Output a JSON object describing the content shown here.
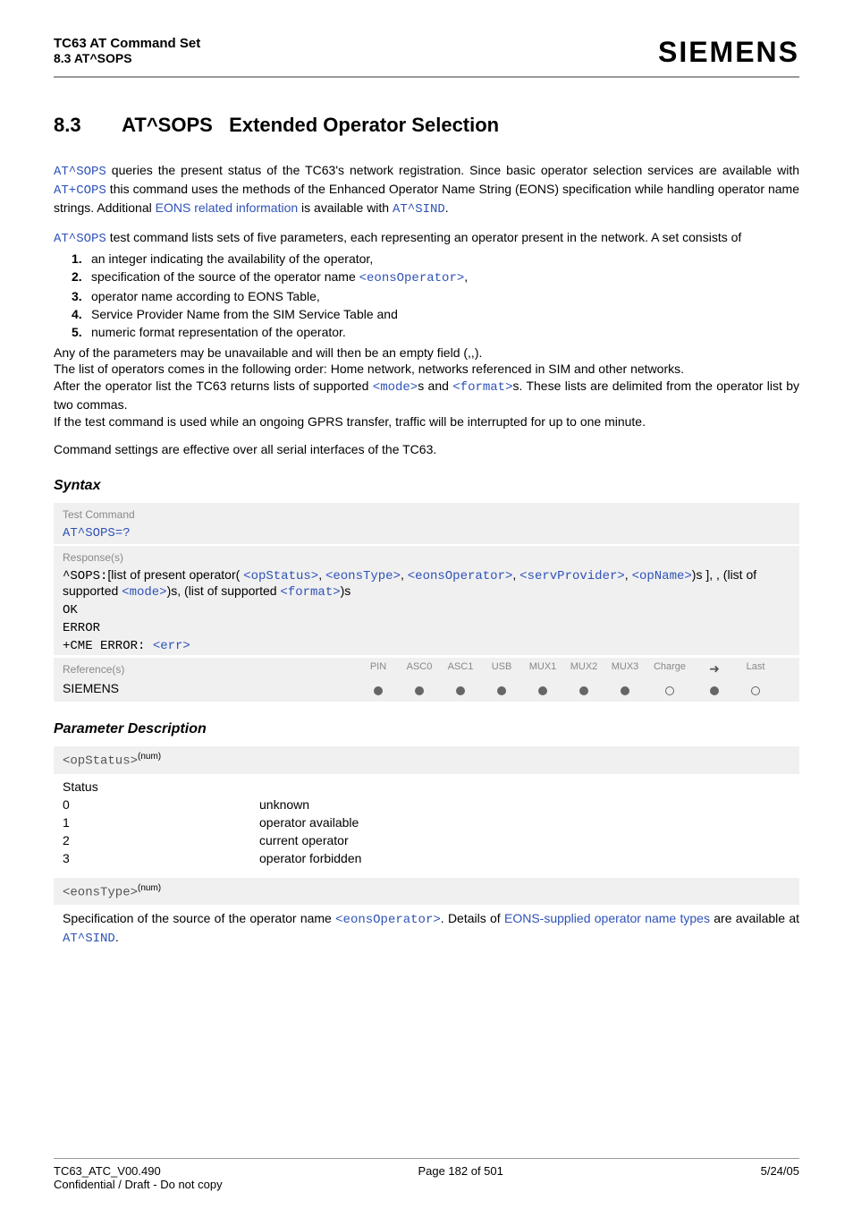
{
  "header": {
    "doc_title": "TC63 AT Command Set",
    "section_label": "8.3 AT^SOPS",
    "brand": "SIEMENS"
  },
  "title": {
    "number": "8.3",
    "cmd": "AT^SOPS",
    "desc": "Extended Operator Selection"
  },
  "intro": {
    "cmd1": "AT^SOPS",
    "p1_part1": " queries the present status of the TC63's network registration. Since basic operator selection services are available with ",
    "cmd2": "AT+COPS",
    "p1_part2": " this command uses the methods of the Enhanced Operator Name String (EONS) specification while handling operator name strings. Additional ",
    "link1": "EONS related information",
    "p1_part3": " is available with ",
    "cmd3": "AT^SIND",
    "p1_part4": "."
  },
  "para2": {
    "cmd": "AT^SOPS",
    "text": " test command lists sets of five parameters, each representing an operator present in the network. A set consists of"
  },
  "list": {
    "i1": "an integer indicating the availability of the operator,",
    "i2a": "specification of the source of the operator name ",
    "i2b": "<eonsOperator>",
    "i2c": ",",
    "i3": "operator name according to EONS Table,",
    "i4": "Service Provider Name from the SIM Service Table and",
    "i5": "numeric format representation of the operator."
  },
  "post": {
    "p1": "Any of the parameters may be unavailable and will then be an empty field (,,).",
    "p2": "The list of operators comes in the following order: Home network, networks referenced in SIM and other networks.",
    "p3a": "After the operator list the TC63 returns lists of supported ",
    "p3m": "<mode>",
    "p3b": "s and ",
    "p3f": "<format>",
    "p3c": "s. These lists are delimited from the operator list by two commas.",
    "p4": "If the test command is used while an ongoing GPRS transfer, traffic will be interrupted for up to one minute.",
    "p5": "Command settings are effective over all serial interfaces of the TC63."
  },
  "syntax_heading": "Syntax",
  "syntax": {
    "test_cmd_label": "Test Command",
    "test_cmd": "AT^SOPS=?",
    "response_label": "Response(s)",
    "resp_prefix": "^SOPS:",
    "resp_text1": "[list of present operator( ",
    "resp_p1": "<opStatus>",
    "resp_c": ", ",
    "resp_p2": "<eonsType>",
    "resp_p3": "<eonsOperator>",
    "resp_p4": "<servProvider>",
    "resp_p5": "<opName>",
    "resp_text2": ")s ], , (list of supported ",
    "resp_p6": "<mode>",
    "resp_text3": ")s, (list of supported ",
    "resp_p7": "<format>",
    "resp_text4": ")s",
    "ok": "OK",
    "error": "ERROR",
    "cme": "+CME ERROR: ",
    "cme_err": "<err>"
  },
  "ref": {
    "label": "Reference(s)",
    "siemens": "SIEMENS",
    "cols": [
      "PIN",
      "ASC0",
      "ASC1",
      "USB",
      "MUX1",
      "MUX2",
      "MUX3",
      "Charge",
      "➜",
      "Last"
    ],
    "dots": [
      "filled",
      "filled",
      "filled",
      "filled",
      "filled",
      "filled",
      "filled",
      "empty",
      "filled",
      "empty"
    ]
  },
  "param_desc_heading": "Parameter Description",
  "param1": {
    "name": "<opStatus>",
    "sup": "(num)",
    "label": "Status",
    "rows": [
      {
        "k": "0",
        "v": "unknown"
      },
      {
        "k": "1",
        "v": "operator available"
      },
      {
        "k": "2",
        "v": "current operator"
      },
      {
        "k": "3",
        "v": "operator forbidden"
      }
    ]
  },
  "param2": {
    "name": "<eonsType>",
    "sup": "(num)",
    "text1": "Specification of the source of the operator name ",
    "link1": "<eonsOperator>",
    "text2": ". Details of ",
    "link2": "EONS-supplied operator name types",
    "text3": " are available at ",
    "cmd": "AT^SIND",
    "text4": "."
  },
  "footer": {
    "left1": "TC63_ATC_V00.490",
    "left2": "Confidential / Draft - Do not copy",
    "center": "Page 182 of 501",
    "right": "5/24/05"
  }
}
